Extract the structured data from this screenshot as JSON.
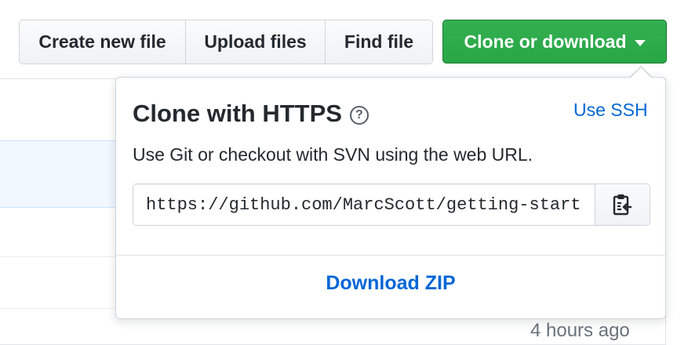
{
  "toolbar": {
    "create_new_file": "Create new file",
    "upload_files": "Upload files",
    "find_file": "Find file",
    "clone_or_download": "Clone or download"
  },
  "background": {
    "last_commit_time": "4 hours ago"
  },
  "clone_panel": {
    "title": "Clone with HTTPS",
    "help_icon": "question-circle-icon",
    "use_ssh": "Use SSH",
    "description": "Use Git or checkout with SVN using the web URL.",
    "url": "https://github.com/MarcScott/getting-started",
    "copy_icon": "clippy-icon",
    "download_zip": "Download ZIP"
  },
  "colors": {
    "accent_green": "#28a745",
    "link_blue": "#0366d6",
    "border": "#d1d5da"
  }
}
